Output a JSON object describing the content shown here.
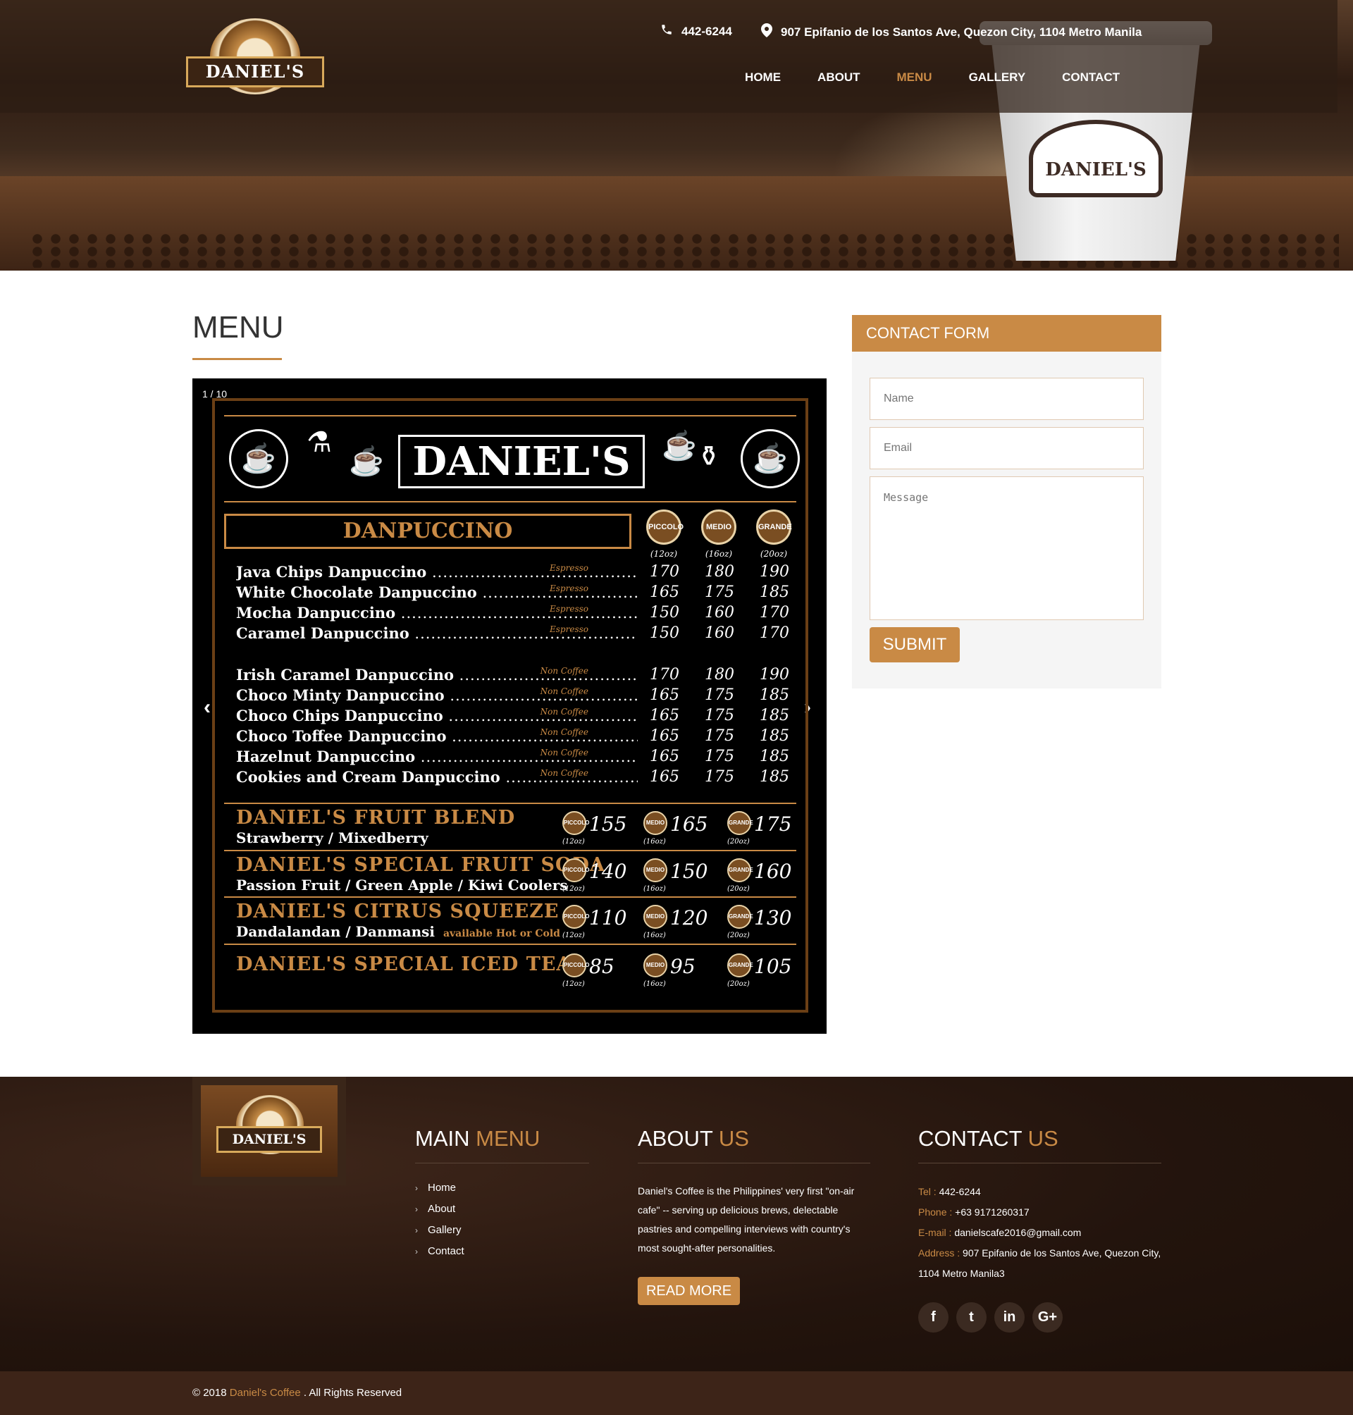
{
  "header": {
    "phone": "442-6244",
    "address": "907 Epifanio de los Santos Ave, Quezon City, 1104 Metro Manila",
    "logo_text": "DANIEL'S",
    "nav": [
      {
        "label": "HOME",
        "active": false
      },
      {
        "label": "ABOUT",
        "active": false
      },
      {
        "label": "MENU",
        "active": true
      },
      {
        "label": "GALLERY",
        "active": false
      },
      {
        "label": "CONTACT",
        "active": false
      }
    ]
  },
  "hero": {
    "cup_logo_text": "DANIEL'S"
  },
  "page": {
    "title": "MENU"
  },
  "slider": {
    "counter": "1 / 10",
    "prev_icon": "chevron-left-icon",
    "next_icon": "chevron-right-icon",
    "board_title": "DANIEL'S",
    "section_title": "DANPUCCINO",
    "sizes": [
      {
        "label": "PICCOLO",
        "oz": "(12oz)"
      },
      {
        "label": "MEDIO",
        "oz": "(16oz)"
      },
      {
        "label": "GRANDE",
        "oz": "(20oz)"
      }
    ],
    "items": [
      {
        "name": "Java Chips Danpuccino",
        "tag": "Espresso",
        "prices": [
          "170",
          "180",
          "190"
        ]
      },
      {
        "name": "White Chocolate Danpuccino",
        "tag": "Espresso",
        "prices": [
          "165",
          "175",
          "185"
        ]
      },
      {
        "name": "Mocha Danpuccino",
        "tag": "Espresso",
        "prices": [
          "150",
          "160",
          "170"
        ]
      },
      {
        "name": "Caramel Danpuccino",
        "tag": "Espresso",
        "prices": [
          "150",
          "160",
          "170"
        ]
      },
      {
        "name": "Irish Caramel Danpuccino",
        "tag": "Non Coffee",
        "prices": [
          "170",
          "180",
          "190"
        ]
      },
      {
        "name": "Choco Minty Danpuccino",
        "tag": "Non Coffee",
        "prices": [
          "165",
          "175",
          "185"
        ]
      },
      {
        "name": "Choco Chips Danpuccino",
        "tag": "Non Coffee",
        "prices": [
          "165",
          "175",
          "185"
        ]
      },
      {
        "name": "Choco Toffee Danpuccino",
        "tag": "Non Coffee",
        "prices": [
          "165",
          "175",
          "185"
        ]
      },
      {
        "name": "Hazelnut Danpuccino",
        "tag": "Non Coffee",
        "prices": [
          "165",
          "175",
          "185"
        ]
      },
      {
        "name": "Cookies and Cream Danpuccino",
        "tag": "Non Coffee",
        "prices": [
          "165",
          "175",
          "185"
        ]
      }
    ],
    "specials": [
      {
        "name": "DANIEL'S FRUIT BLEND",
        "sub": "Strawberry / Mixedberry",
        "note": "",
        "prices": [
          "155",
          "165",
          "175"
        ]
      },
      {
        "name": "DANIEL'S SPECIAL FRUIT SODA",
        "sub": "Passion Fruit / Green Apple / Kiwi Coolers",
        "note": "",
        "prices": [
          "140",
          "150",
          "160"
        ]
      },
      {
        "name": "DANIEL'S CITRUS SQUEEZE",
        "sub": "Dandalandan / Danmansi",
        "note": "available Hot or Cold",
        "prices": [
          "110",
          "120",
          "130"
        ]
      },
      {
        "name": "DANIEL'S SPECIAL ICED TEA",
        "sub": "",
        "note": "",
        "prices": [
          "85",
          "95",
          "105"
        ]
      }
    ]
  },
  "contact_form": {
    "title": "CONTACT FORM",
    "name_placeholder": "Name",
    "email_placeholder": "Email",
    "message_placeholder": "Message",
    "submit_label": "SUBMIT"
  },
  "footer": {
    "logo_text": "DANIEL'S",
    "main_menu": {
      "title_a": "MAIN ",
      "title_b": "MENU",
      "links": [
        "Home",
        "About",
        "Gallery",
        "Contact"
      ]
    },
    "about": {
      "title_a": "ABOUT ",
      "title_b": "US",
      "text": "Daniel's Coffee is the Philippines' very first \"on-air cafe\" -- serving up delicious brews, delectable pastries and compelling interviews with country's most sought-after personalities.",
      "button": "READ MORE"
    },
    "contact": {
      "title_a": "CONTACT ",
      "title_b": "US",
      "tel_label": "Tel :",
      "tel": "442-6244",
      "phone_label": "Phone :",
      "phone": "+63 9171260317",
      "email_label": "E-mail :",
      "email": "danielscafe2016@gmail.com",
      "address_label": "Address :",
      "address": "907 Epifanio de los Santos Ave, Quezon City, 1104 Metro Manila3",
      "social": [
        {
          "icon": "facebook-icon",
          "glyph": "f"
        },
        {
          "icon": "twitter-icon",
          "glyph": "t"
        },
        {
          "icon": "linkedin-icon",
          "glyph": "in"
        },
        {
          "icon": "google-plus-icon",
          "glyph": "G+"
        }
      ]
    },
    "copyright_a": "© 2018",
    "copyright_brand": "Daniel's Coffee",
    "copyright_b": ". All Rights Reserved"
  },
  "colors": {
    "accent": "#c98a45",
    "dark_brown": "#3d2418"
  }
}
